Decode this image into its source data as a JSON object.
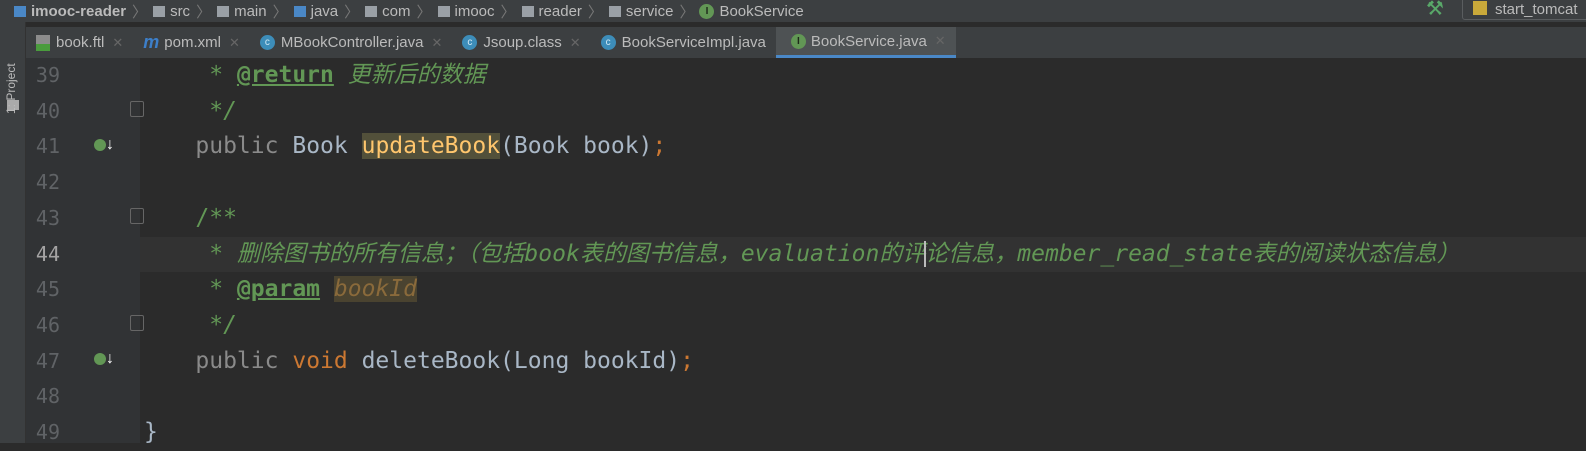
{
  "breadcrumb": [
    "imooc-reader",
    "src",
    "main",
    "java",
    "com",
    "imooc",
    "reader",
    "service",
    "BookService"
  ],
  "run_config": "start_tomcat",
  "sidebar": {
    "project_label": "1: Project"
  },
  "tabs": [
    {
      "label": "book.ftl",
      "icon": "ftl-file-icon"
    },
    {
      "label": "pom.xml",
      "icon": "maven-icon"
    },
    {
      "label": "MBookController.java",
      "icon": "class-icon"
    },
    {
      "label": "Jsoup.class",
      "icon": "class-icon"
    },
    {
      "label": "BookServiceImpl.java",
      "icon": "class-icon"
    },
    {
      "label": "BookService.java",
      "icon": "interface-icon",
      "active": true
    }
  ],
  "code": {
    "line_numbers": [
      "39",
      "40",
      "41",
      "42",
      "43",
      "44",
      "45",
      "46",
      "47",
      "48",
      "49"
    ],
    "l39": {
      "star": "     * ",
      "tag": "@return",
      "text": " 更新后的数据"
    },
    "l40": "     */",
    "l41": {
      "indent": "    ",
      "kw": "public",
      "sp": " ",
      "type": "Book ",
      "fn": "updateBook",
      "args": "(Book book)",
      "semi": ";"
    },
    "l43": "    /**",
    "l44a": "     * 删除图书的所有信息；（包括book表的图书信息，evaluation的评",
    "l44b": "论信息，member_read_state表的阅读状态信息）",
    "l45": {
      "star": "     * ",
      "tag": "@param",
      "sp": " ",
      "param": "bookId"
    },
    "l46": "     */",
    "l47": {
      "indent": "    ",
      "kw": "public",
      "sp": " ",
      "void": "void",
      "rest": " deleteBook(Long bookId)",
      "semi": ";"
    },
    "l49": "}"
  },
  "colors": {
    "bg": "#2b2b2b",
    "keyword": "#cc7832",
    "comment": "#629755",
    "method": "#ffc66d",
    "text": "#a9b7c6"
  }
}
